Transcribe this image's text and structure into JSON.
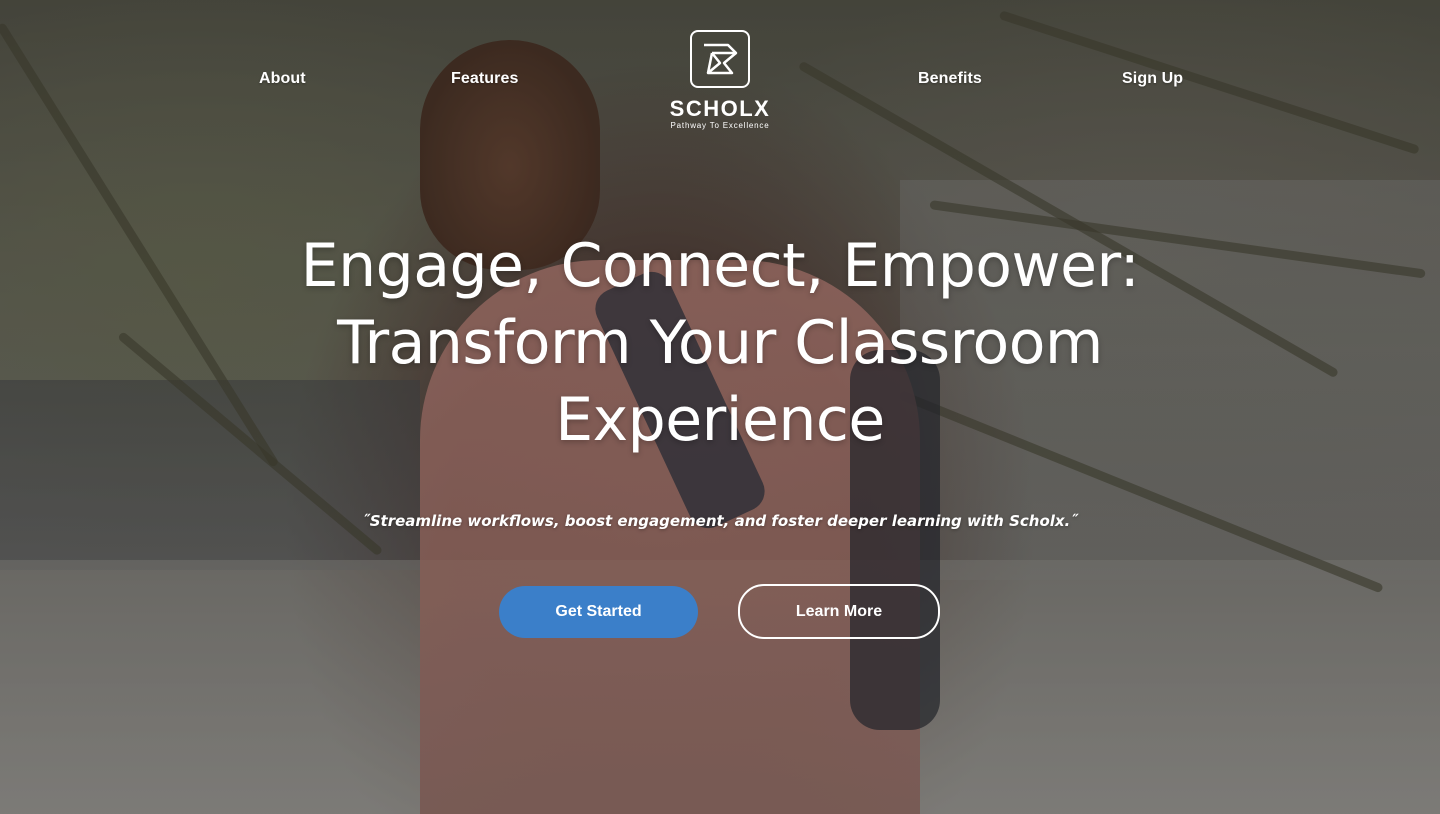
{
  "nav": {
    "about": "About",
    "features": "Features",
    "benefits": "Benefits",
    "signup": "Sign Up"
  },
  "logo": {
    "name": "SCHOLX",
    "tagline": "Pathway To Excellence",
    "icon": "scholx-logo-icon"
  },
  "hero": {
    "headline_line1": "Engage, Connect, Empower:",
    "headline_line2": "Transform Your Classroom",
    "headline_line3": "Experience",
    "tagline": "˝Streamline workflows, boost engagement, and foster deeper learning with Scholx.˝",
    "primary_button": "Get Started",
    "secondary_button": "Learn More"
  },
  "colors": {
    "primary_button": "#3b7fc9",
    "text": "#ffffff"
  }
}
